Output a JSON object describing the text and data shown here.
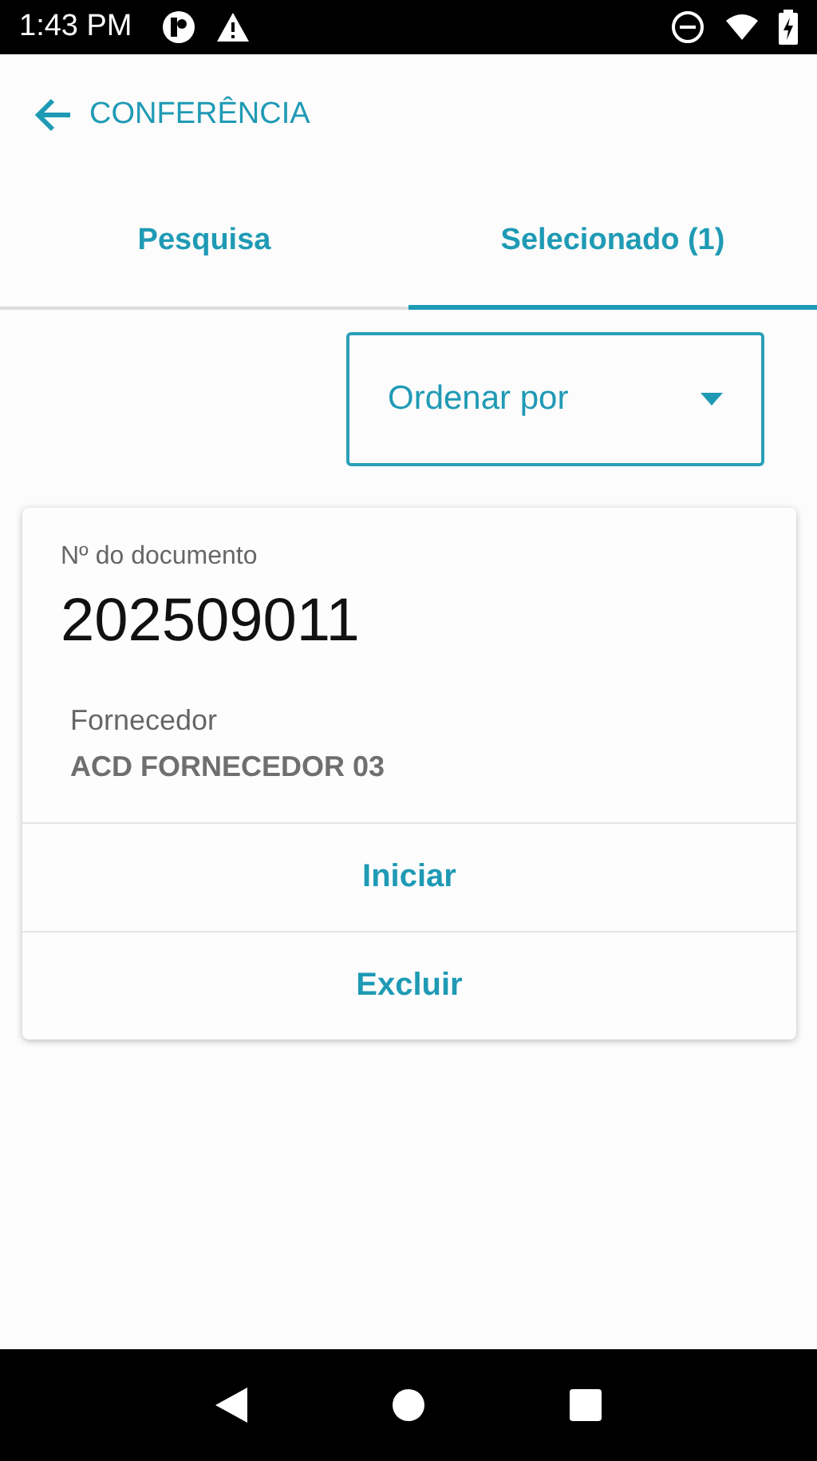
{
  "status_bar": {
    "time": "1:43 PM"
  },
  "header": {
    "title": "CONFERÊNCIA"
  },
  "tabs": [
    {
      "label": "Pesquisa",
      "selected": false
    },
    {
      "label": "Selecionado (1)",
      "selected": true
    }
  ],
  "sort_dropdown": {
    "placeholder": "Ordenar por"
  },
  "documents": [
    {
      "number_label": "Nº do documento",
      "number": "202509011",
      "supplier_label": "Fornecedor",
      "supplier": "ACD FORNECEDOR 03",
      "actions": [
        "Iniciar",
        "Excluir"
      ]
    }
  ]
}
